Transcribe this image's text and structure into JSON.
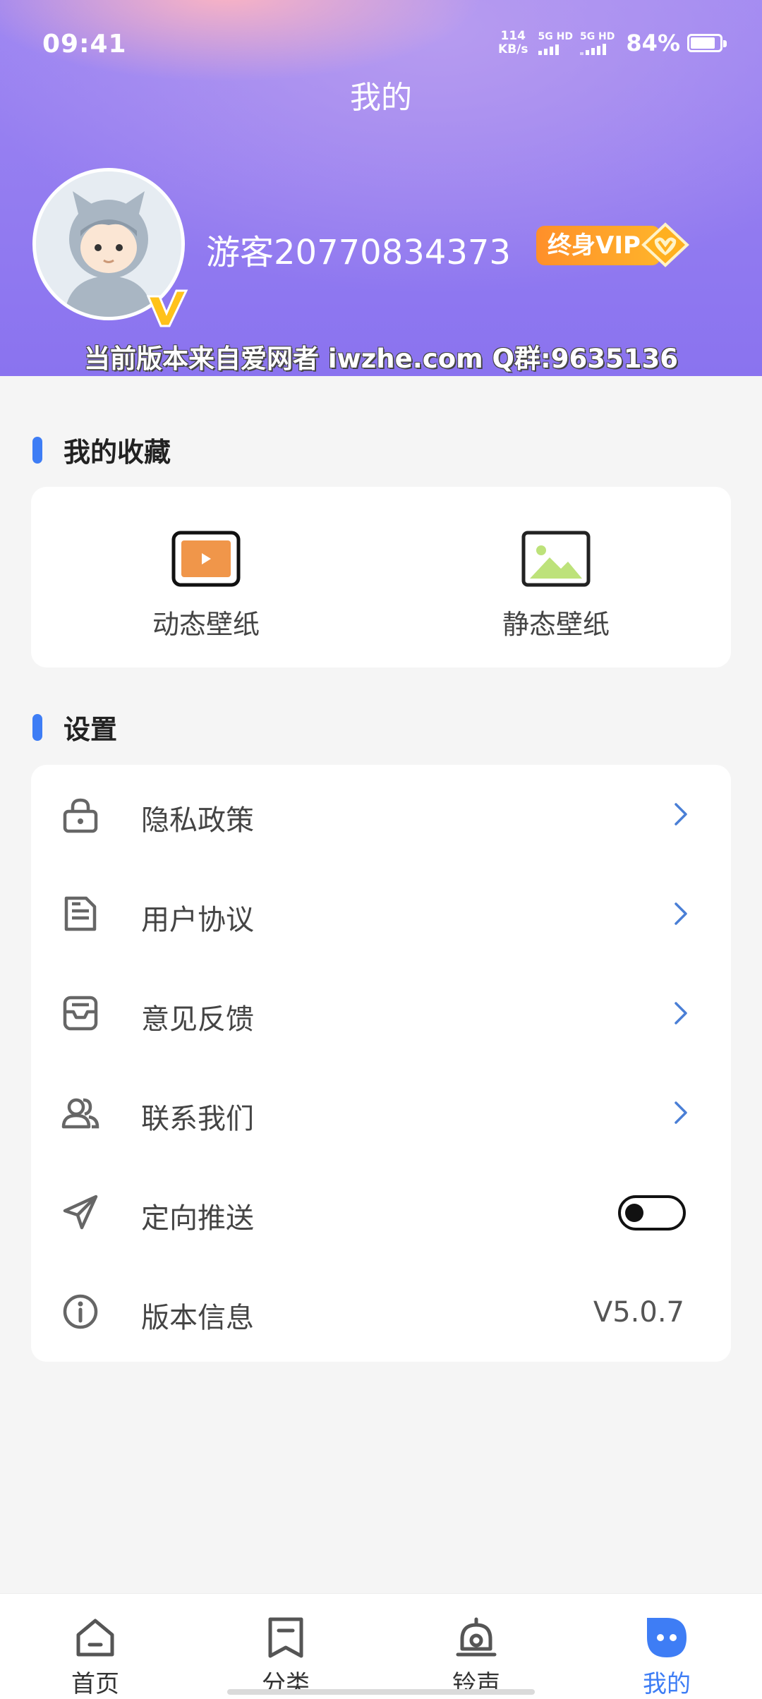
{
  "status_bar": {
    "time": "09:41",
    "net_speed_value": "114",
    "net_speed_unit": "KB/s",
    "sim1_label": "5G HD",
    "sim2_label": "5G HD",
    "battery_percent": "84%",
    "battery_level": 0.84
  },
  "header": {
    "title": "我的",
    "username": "游客20770834373",
    "vip_label": "终身VIP",
    "watermark": "当前版本来自爱网者 iwzhe.com  Q群:9635136"
  },
  "favorites": {
    "section_title": "我的收藏",
    "items": [
      {
        "label": "动态壁纸",
        "icon": "video-icon"
      },
      {
        "label": "静态壁纸",
        "icon": "image-icon"
      }
    ]
  },
  "settings": {
    "section_title": "设置",
    "items": [
      {
        "label": "隐私政策",
        "icon": "lock-icon",
        "trailing": "chevron"
      },
      {
        "label": "用户协议",
        "icon": "document-icon",
        "trailing": "chevron"
      },
      {
        "label": "意见反馈",
        "icon": "feedback-icon",
        "trailing": "chevron"
      },
      {
        "label": "联系我们",
        "icon": "contacts-icon",
        "trailing": "chevron"
      },
      {
        "label": "定向推送",
        "icon": "send-icon",
        "trailing": "toggle",
        "toggle_on": false
      },
      {
        "label": "版本信息",
        "icon": "info-icon",
        "trailing": "value",
        "value": "V5.0.7"
      }
    ]
  },
  "tabbar": {
    "items": [
      {
        "label": "首页",
        "icon": "home-icon",
        "active": false
      },
      {
        "label": "分类",
        "icon": "bookmark-icon",
        "active": false
      },
      {
        "label": "铃声",
        "icon": "bell-icon",
        "active": false
      },
      {
        "label": "我的",
        "icon": "profile-icon",
        "active": true
      }
    ]
  },
  "colors": {
    "accent": "#3e7df5",
    "header_gradient_start": "#9d86f2",
    "vip_orange": "#ff9f2a"
  }
}
